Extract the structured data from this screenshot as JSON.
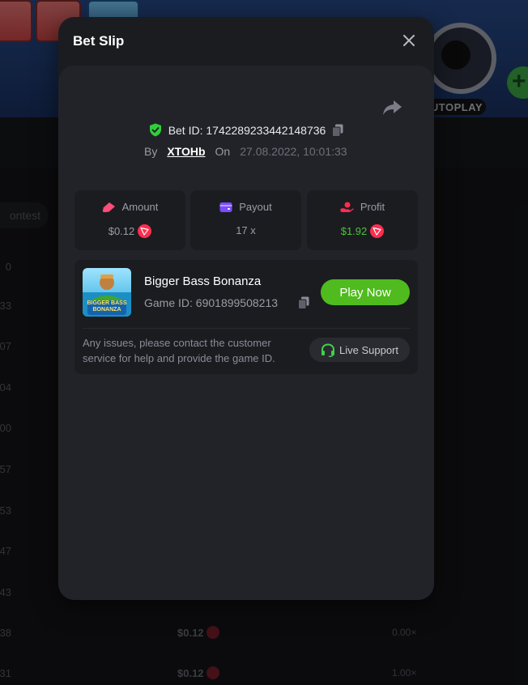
{
  "modal": {
    "title": "Bet Slip"
  },
  "bet": {
    "id_label": "Bet ID:",
    "id": "1742289233442148736",
    "by_label": "By",
    "user": "XTOHb",
    "on_label": "On",
    "date": "27.08.2022, 10:01:33"
  },
  "stats": {
    "amount_label": "Amount",
    "amount_value": "$0.12",
    "payout_label": "Payout",
    "payout_value": "17 x",
    "profit_label": "Profit",
    "profit_value": "$1.92"
  },
  "game": {
    "thumb_text": "BIGGER BASS BONANZA",
    "name": "Bigger Bass Bonanza",
    "id_text": "Game ID: 6901899508213",
    "play_label": "Play Now",
    "support_text": "Any issues, please contact the customer service for help and provide the game ID.",
    "support_label": "Live Support"
  },
  "background": {
    "autoplay_label": "UTOPLAY",
    "contest_label": "ontest",
    "rows": [
      {
        "num": "0"
      },
      {
        "num": "33"
      },
      {
        "num": "07"
      },
      {
        "num": "04"
      },
      {
        "num": "00"
      },
      {
        "num": "57"
      },
      {
        "num": "53"
      },
      {
        "num": "47"
      },
      {
        "num": "43"
      },
      {
        "num": "38",
        "amount": "$0.12",
        "mult": "0.00×"
      },
      {
        "num": "31",
        "amount": "$0.12",
        "mult": "1.00×"
      }
    ]
  },
  "colors": {
    "accent_green": "#4fbb1e",
    "profit_green": "#4cc23c",
    "trx_red": "#ff2d4f",
    "payout_purple": "#7b4dff",
    "amount_pink": "#ff4d7a",
    "shield_green": "#2fcf3a"
  },
  "icons": [
    "shield-check-icon",
    "copy-icon",
    "share-icon",
    "close-icon",
    "amount-icon",
    "wallet-icon",
    "profit-icon",
    "trx-coin-icon",
    "headset-icon"
  ]
}
